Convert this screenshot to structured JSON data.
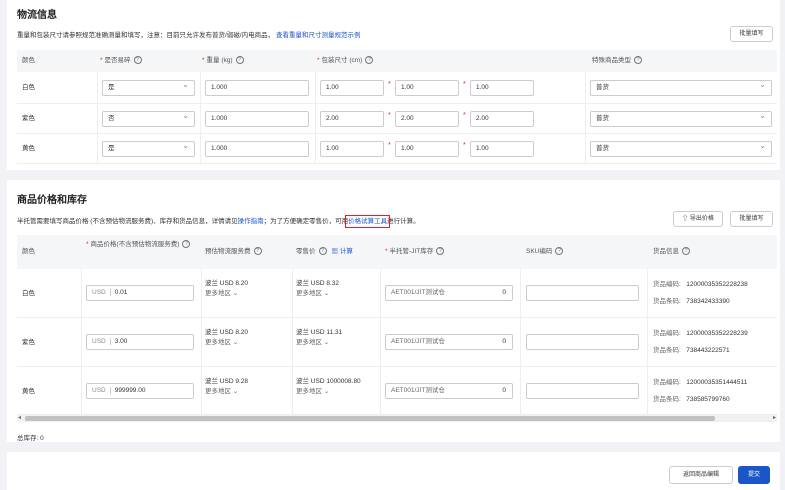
{
  "logistics": {
    "title": "物流信息",
    "note": "重量和包装尺寸请参照规范准确测量和填写，注意：目前只允许发布普货/弱磁/内电商品，",
    "note_link": "查看重量和尺寸测量规范示例",
    "batch_btn": "批量填写",
    "headers": {
      "color": "颜色",
      "fragile": "是否易碎",
      "weight": "重量 (kg)",
      "size": "包装尺寸 (cm)",
      "special": "特殊商品类型"
    },
    "rows": [
      {
        "color": "白色",
        "fragile": "是",
        "weight": "1.000",
        "l": "1.00",
        "w": "1.00",
        "h": "1.00",
        "special": "普货"
      },
      {
        "color": "紫色",
        "fragile": "否",
        "weight": "1.000",
        "l": "2.00",
        "w": "2.00",
        "h": "2.00",
        "special": "普货"
      },
      {
        "color": "黄色",
        "fragile": "是",
        "weight": "1.000",
        "l": "1.00",
        "w": "1.00",
        "h": "1.00",
        "special": "普货"
      }
    ]
  },
  "pricing": {
    "title": "商品价格和库存",
    "note_pre": "半托管需要填写商品价格 (不含预估物流服务费)、库存和货品信息，详情请见",
    "note_link1": "操作指南",
    "note_mid": "；为了方便确定零售价，可用",
    "note_link2": "价格试算工具",
    "note_post": "进行计算。",
    "export_btn": "导出价格",
    "batch_btn": "批量填写",
    "headers": {
      "color": "颜色",
      "price": "商品价格(不含预估物流服务费)",
      "logistics_fee": "预估物流服务费",
      "retail": "零售价",
      "calc": "计算",
      "stock": "半托管-JIT库存",
      "sku": "SKU编码",
      "goods": "货品信息"
    },
    "rows": [
      {
        "color": "白色",
        "currency": "USD",
        "price": "0.01",
        "fee": "波兰 USD 8.20",
        "fee_more": "更多地区",
        "retail": "波兰 USD 8.32",
        "retail_more": "更多地区",
        "warehouse": "AET001/JIT测试仓",
        "stock": "0",
        "sku": "",
        "goods_code_label": "货品编码:",
        "goods_code": "12000035352228238",
        "goods_barcode_label": "货品条码:",
        "goods_barcode": "738342433390"
      },
      {
        "color": "紫色",
        "currency": "USD",
        "price": "3.00",
        "fee": "波兰 USD 8.20",
        "fee_more": "更多地区",
        "retail": "波兰 USD 11.31",
        "retail_more": "更多地区",
        "warehouse": "AET001/JIT测试仓",
        "stock": "0",
        "sku": "",
        "goods_code_label": "货品编码:",
        "goods_code": "12000035352228239",
        "goods_barcode_label": "货品条码:",
        "goods_barcode": "738443222571"
      },
      {
        "color": "黄色",
        "currency": "USD",
        "price": "999999.00",
        "fee": "波兰 USD 9.28",
        "fee_more": "更多地区",
        "retail": "波兰 USD 1000008.80",
        "retail_more": "更多地区",
        "warehouse": "AET001/JIT测试仓",
        "stock": "0",
        "sku": "",
        "goods_code_label": "货品编码:",
        "goods_code": "12000035351444511",
        "goods_barcode_label": "货品条码:",
        "goods_barcode": "738585799760"
      }
    ],
    "total_stock": "总库存:  0"
  },
  "footer": {
    "back_btn": "返回商品编辑",
    "submit_btn": "提交"
  },
  "colors": {
    "primary": "#1a56c8",
    "required": "#e02020",
    "highlight": "#e02020"
  }
}
